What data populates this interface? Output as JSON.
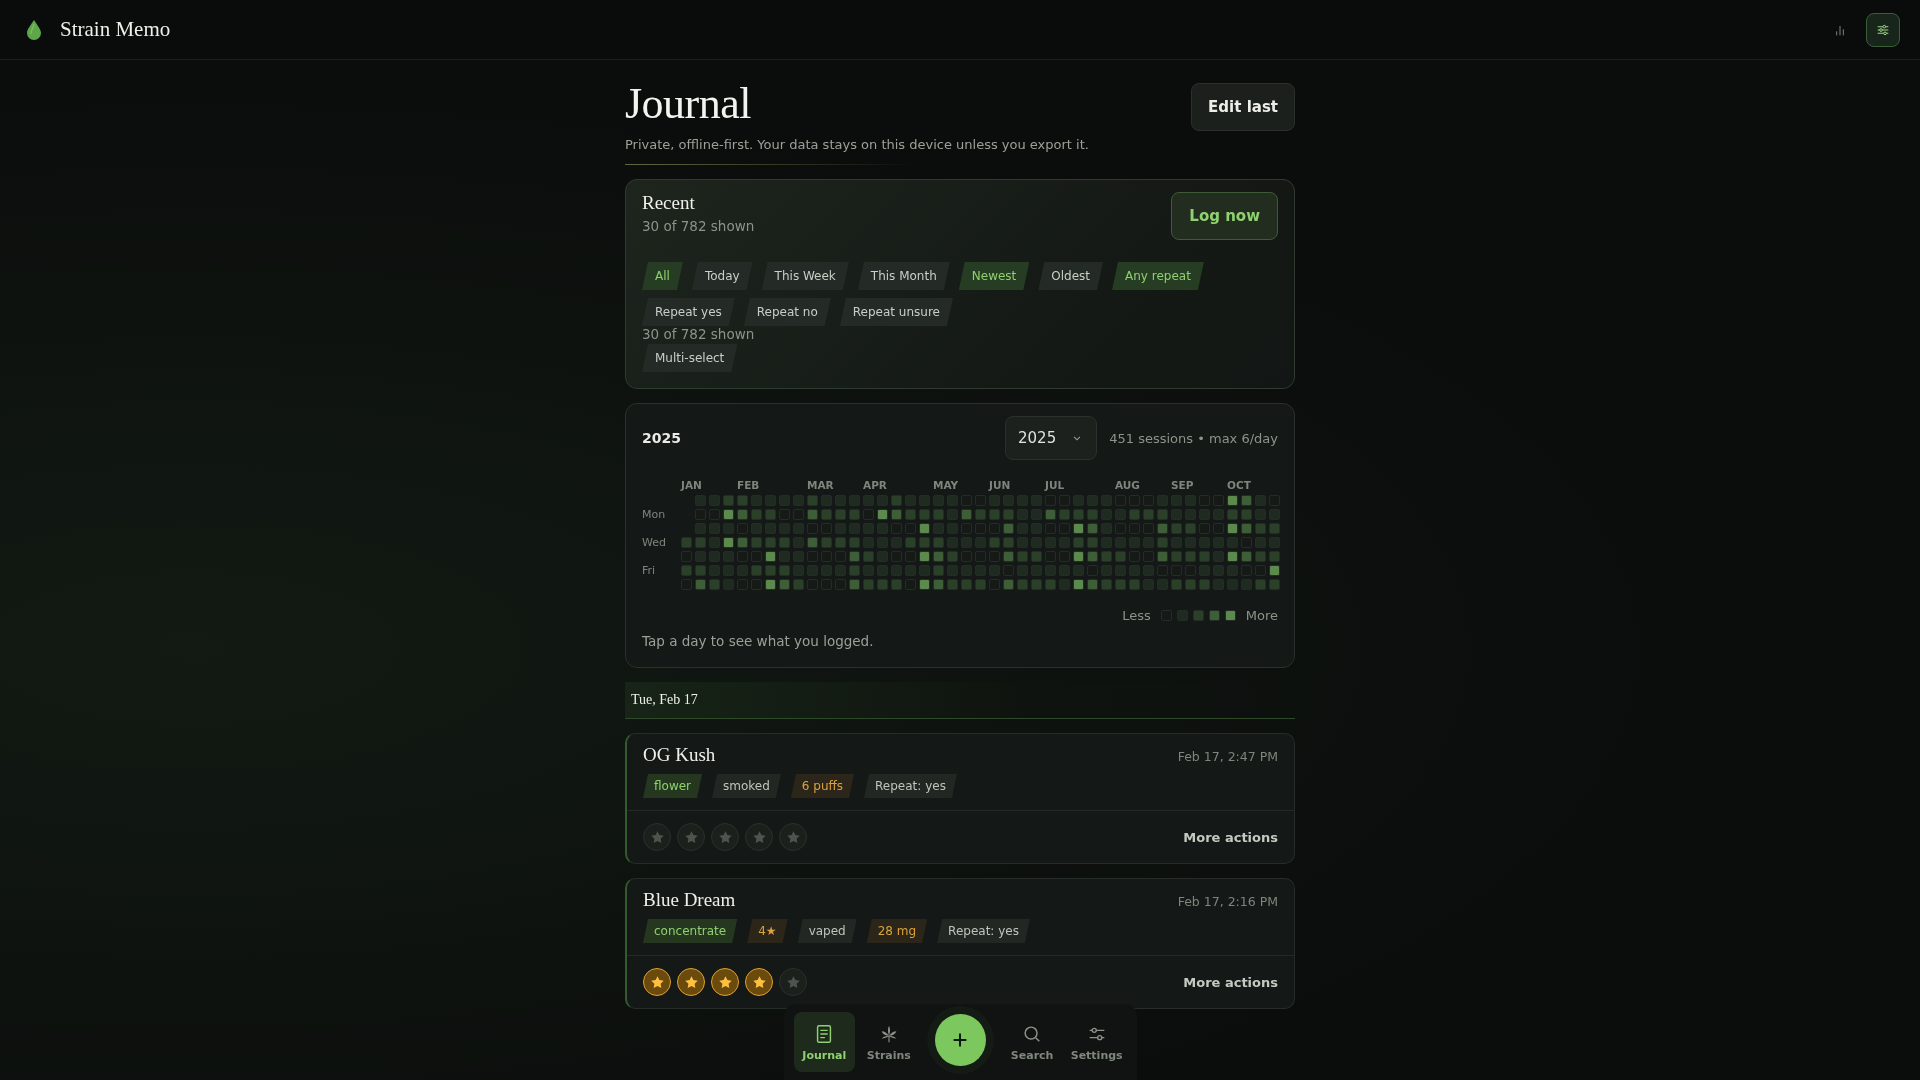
{
  "app": {
    "title": "Strain Memo"
  },
  "header": {
    "title": "Journal",
    "subtitle": "Private, offline-first. Your data stays on this device unless you export it.",
    "edit_button": "Edit last"
  },
  "recent": {
    "title": "Recent",
    "count": "30 of 782 shown",
    "log_button": "Log now",
    "filters": [
      {
        "label": "All",
        "selected": true
      },
      {
        "label": "Today",
        "selected": false
      },
      {
        "label": "This Week",
        "selected": false
      },
      {
        "label": "This Month",
        "selected": false
      },
      {
        "label": "Newest",
        "selected": true
      },
      {
        "label": "Oldest",
        "selected": false
      },
      {
        "label": "Any repeat",
        "selected": true
      }
    ],
    "repeat_filters": [
      {
        "label": "Repeat yes",
        "selected": false
      },
      {
        "label": "Repeat no",
        "selected": false
      },
      {
        "label": "Repeat unsure",
        "selected": false
      }
    ],
    "filter_count": "30 of 782 shown",
    "multi_select": "Multi-select"
  },
  "heatmap": {
    "title": "2025",
    "year_select": "2025",
    "summary": "451 sessions • max 6/day",
    "months": [
      "JAN",
      "FEB",
      "MAR",
      "APR",
      "MAY",
      "JUN",
      "JUL",
      "AUG",
      "SEP",
      "OCT"
    ],
    "weekdays": [
      "Mon",
      "Wed",
      "Fri"
    ],
    "legend_less": "Less",
    "legend_more": "More",
    "hint": "Tap a day to see what you logged."
  },
  "day_header": "Tue, Feb 17",
  "entries": [
    {
      "name": "OG Kush",
      "time": "Feb 17, 2:47 PM",
      "tags": [
        {
          "kind": "type",
          "label": "flower"
        },
        {
          "kind": "method",
          "label": "smoked"
        },
        {
          "kind": "amount",
          "label": "6 puffs"
        },
        {
          "kind": "repeat",
          "label": "Repeat: yes"
        }
      ],
      "stars": 0,
      "actions": "More actions"
    },
    {
      "name": "Blue Dream",
      "time": "Feb 17, 2:16 PM",
      "tags": [
        {
          "kind": "type",
          "label": "concentrate"
        },
        {
          "kind": "amount",
          "label": "4★"
        },
        {
          "kind": "method",
          "label": "vaped"
        },
        {
          "kind": "amount",
          "label": "28 mg"
        },
        {
          "kind": "repeat",
          "label": "Repeat: yes"
        }
      ],
      "stars": 4,
      "actions": "More actions"
    }
  ],
  "nav": {
    "items": [
      {
        "label": "Journal",
        "selected": true
      },
      {
        "label": "Strains",
        "selected": false
      },
      {
        "label": "Search",
        "selected": false
      },
      {
        "label": "Settings",
        "selected": false
      }
    ]
  }
}
